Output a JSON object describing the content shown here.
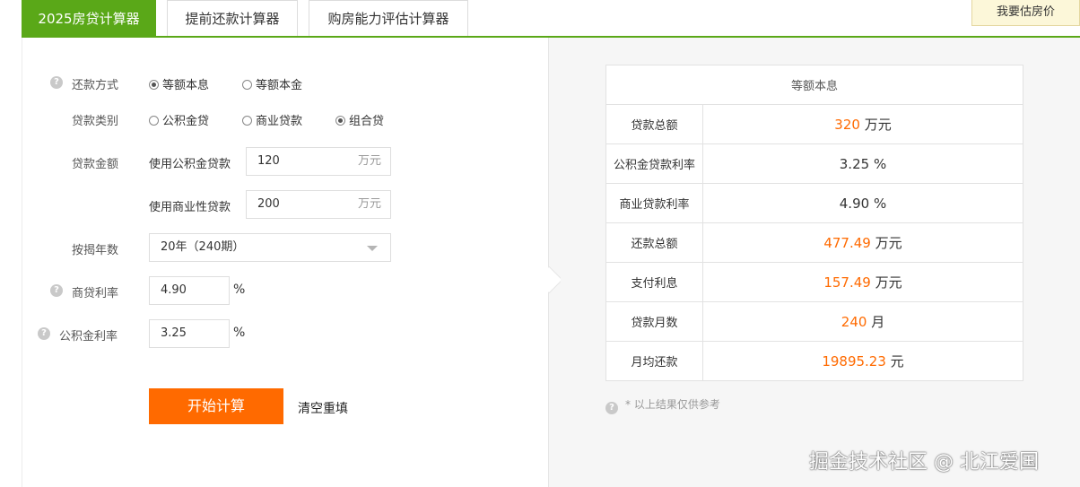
{
  "tabs": {
    "calc2025": "2025房贷计算器",
    "prepay": "提前还款计算器",
    "affordability": "购房能力评估计算器",
    "estimate_button": "我要估房价"
  },
  "form": {
    "help_glyph": "?",
    "repay_method": {
      "label": "还款方式",
      "options": [
        "等额本息",
        "等额本金"
      ],
      "selected": "等额本息"
    },
    "loan_type": {
      "label": "贷款类别",
      "options": [
        "公积金贷",
        "商业贷款",
        "组合贷"
      ],
      "selected": "组合贷"
    },
    "loan_amount": {
      "label": "贷款金额",
      "fund_label": "使用公积金贷款",
      "fund_value": "120",
      "commercial_label": "使用商业性贷款",
      "commercial_value": "200",
      "unit": "万元"
    },
    "years": {
      "label": "按揭年数",
      "value": "20年（240期）"
    },
    "commercial_rate": {
      "label": "商贷利率",
      "value": "4.90",
      "unit": "%"
    },
    "fund_rate": {
      "label": "公积金利率",
      "value": "3.25",
      "unit": "%"
    },
    "calc_button": "开始计算",
    "clear_button": "清空重填"
  },
  "result": {
    "header": "等额本息",
    "rows": [
      {
        "label": "贷款总额",
        "value": "320",
        "unit": "万元",
        "color": "#ff6a00"
      },
      {
        "label": "公积金贷款利率",
        "value": "3.25",
        "unit": "%",
        "color": "#333333"
      },
      {
        "label": "商业贷款利率",
        "value": "4.90",
        "unit": "%",
        "color": "#333333"
      },
      {
        "label": "还款总额",
        "value": "477.49",
        "unit": "万元",
        "color": "#ff6a00"
      },
      {
        "label": "支付利息",
        "value": "157.49",
        "unit": "万元",
        "color": "#ff6a00"
      },
      {
        "label": "贷款月数",
        "value": "240",
        "unit": "月",
        "color": "#ff6a00"
      },
      {
        "label": "月均还款",
        "value": "19895.23",
        "unit": "元",
        "color": "#ff6a00"
      }
    ],
    "note": "* 以上结果仅供参考"
  },
  "watermark": "掘金技术社区 @ 北江爱国",
  "colors": {
    "accent_green": "#5aa818",
    "accent_orange": "#ff6a00"
  }
}
